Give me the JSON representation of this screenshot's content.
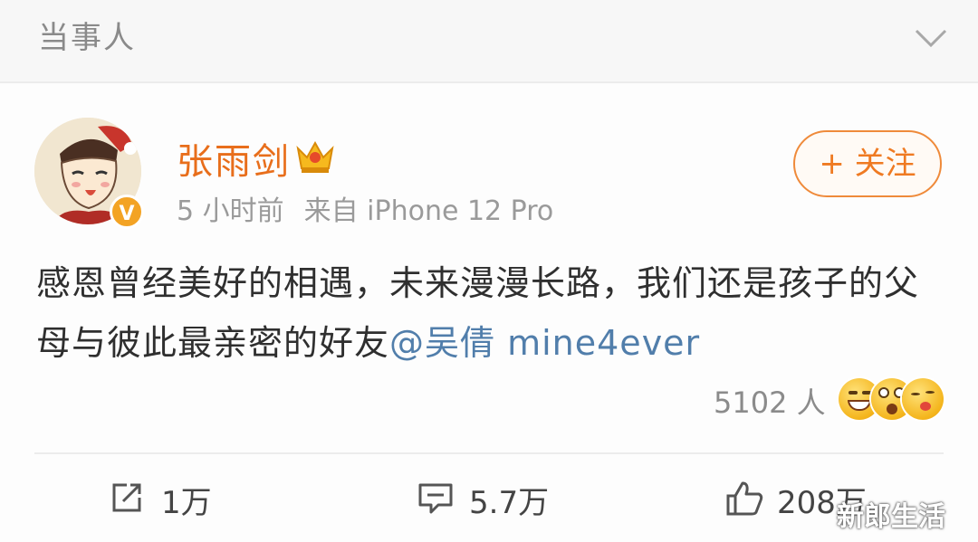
{
  "header": {
    "title": "当事人"
  },
  "post": {
    "author": "张雨剑",
    "time": "5 小时前",
    "source": "来自 iPhone 12 Pro",
    "follow_label": "+ 关注",
    "verified_badge": "V",
    "text": "感恩曾经美好的相遇，未来漫漫长路，我们还是孩子的父母与彼此最亲密的好友",
    "mention": "@吴倩 mine4ever",
    "reaction_count": "5102 人",
    "reaction_icons": [
      "laugh-emoji-icon",
      "surprised-emoji-icon",
      "kiss-emoji-icon"
    ]
  },
  "actions": {
    "repost": "1万",
    "comment": "5.7万",
    "like": "208万"
  },
  "watermark": "新郎生活",
  "colors": {
    "author": "#e86e1b",
    "mention": "#517eab",
    "follow": "#ef7a22",
    "verified": "#f3a324"
  }
}
